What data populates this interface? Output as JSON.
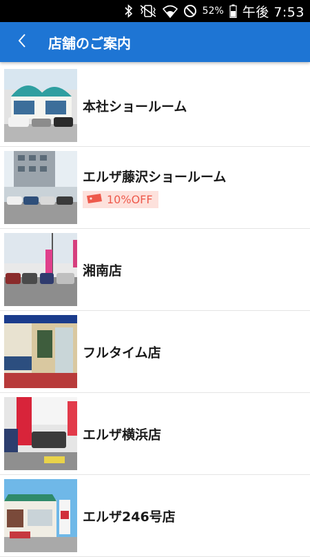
{
  "status_bar": {
    "battery": "52%",
    "time": "午後 7:53"
  },
  "app_bar": {
    "title": "店舗のご案内"
  },
  "stores": [
    {
      "name": "本社ショールーム",
      "coupon": null
    },
    {
      "name": "エルザ藤沢ショールーム",
      "coupon": "10%OFF"
    },
    {
      "name": "湘南店",
      "coupon": null
    },
    {
      "name": "フルタイム店",
      "coupon": null
    },
    {
      "name": "エルザ横浜店",
      "coupon": null
    },
    {
      "name": "エルザ246号店",
      "coupon": null
    }
  ],
  "colors": {
    "app_bar": "#1e75d4",
    "coupon_text": "#ee5a4c",
    "coupon_bg": "#fde1dc"
  },
  "icons": [
    "bluetooth-icon",
    "vibrate-icon",
    "wifi-icon",
    "do-not-disturb-icon",
    "battery-icon",
    "back-arrow-icon",
    "coupon-ticket-icon"
  ]
}
